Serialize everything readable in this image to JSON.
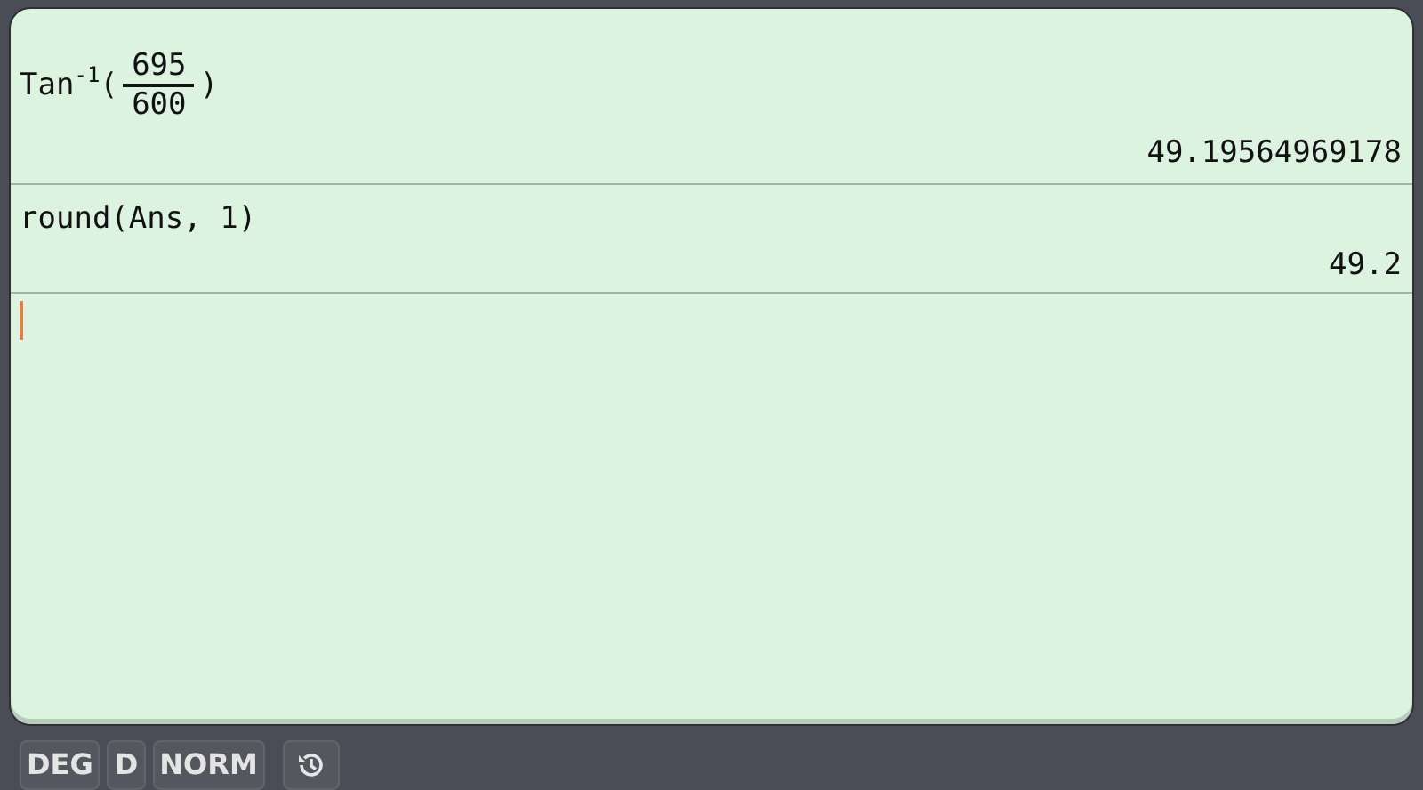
{
  "history": [
    {
      "input": [
        {
          "kind": "text",
          "text": "Tan"
        },
        {
          "kind": "sup",
          "text": "-1"
        },
        {
          "kind": "text",
          "text": "("
        },
        {
          "kind": "fraction",
          "numerator": "695",
          "denominator": "600"
        },
        {
          "kind": "text",
          "text": ")"
        }
      ],
      "result": "49.19564969178"
    },
    {
      "input": [
        {
          "kind": "text",
          "text": "round(Ans, 1)"
        }
      ],
      "result": "49.2"
    }
  ],
  "status_bar": {
    "chips": [
      "DEG",
      "D",
      "NORM"
    ]
  }
}
